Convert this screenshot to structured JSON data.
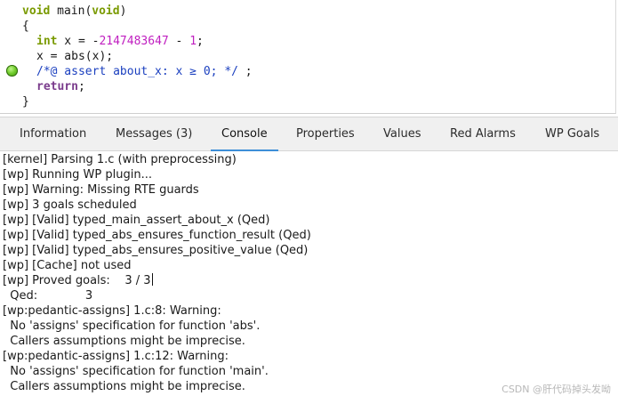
{
  "editor": {
    "line1": {
      "kw1": "void",
      "mid": " main(",
      "kw2": "void",
      "end": ")"
    },
    "line2": "{",
    "line3": {
      "kw": "int",
      "mid": " x = -",
      "num1": "2147483647",
      "mid2": " - ",
      "num2": "1",
      "end": ";"
    },
    "line4": "x = abs(x);",
    "line5": {
      "acsl": "/*@ assert about_x: x ≥ 0; */",
      "end": " ;"
    },
    "line6": {
      "kw": "return",
      "end": ";"
    },
    "line7": "}",
    "status_dot_color": "#5fbf20"
  },
  "tabs": [
    {
      "label": "Information"
    },
    {
      "label": "Messages (3)"
    },
    {
      "label": "Console"
    },
    {
      "label": "Properties"
    },
    {
      "label": "Values"
    },
    {
      "label": "Red Alarms"
    },
    {
      "label": "WP Goals"
    }
  ],
  "active_tab": "Console",
  "accent_color": "#3d8fd8",
  "console": {
    "lines": [
      "[kernel] Parsing 1.c (with preprocessing)",
      "[wp] Running WP plugin...",
      "[wp] Warning: Missing RTE guards",
      "[wp] 3 goals scheduled",
      "[wp] [Valid] typed_main_assert_about_x (Qed)",
      "[wp] [Valid] typed_abs_ensures_function_result (Qed)",
      "[wp] [Valid] typed_abs_ensures_positive_value (Qed)",
      "[wp] [Cache] not used",
      "[wp] Proved goals:    3 / 3",
      "  Qed:             3",
      "[wp:pedantic-assigns] 1.c:8: Warning:",
      "  No 'assigns' specification for function 'abs'.",
      "  Callers assumptions might be imprecise.",
      "[wp:pedantic-assigns] 1.c:12: Warning:",
      "  No 'assigns' specification for function 'main'.",
      "  Callers assumptions might be imprecise."
    ]
  },
  "watermark": "CSDN @肝代码掉头发呦"
}
